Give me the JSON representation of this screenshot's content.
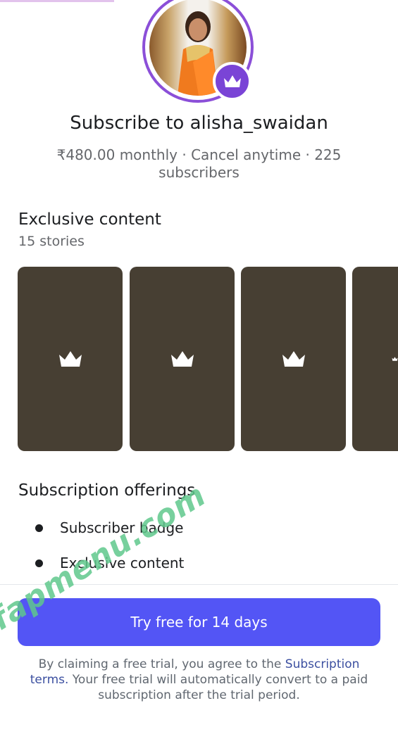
{
  "header": {
    "title": "Subscribe to alisha_swaidan",
    "subtitle": "₹480.00 monthly · Cancel anytime · 225 subscribers"
  },
  "exclusive": {
    "heading": "Exclusive content",
    "count_label": "15 stories",
    "cards": [
      {
        "icon": "crown-icon"
      },
      {
        "icon": "crown-icon"
      },
      {
        "icon": "crown-icon"
      },
      {
        "icon": "crown-icon"
      }
    ]
  },
  "offerings": {
    "heading": "Subscription offerings",
    "items": [
      "Subscriber badge",
      "Exclusive content"
    ]
  },
  "cta": {
    "label": "Try free for 14 days"
  },
  "legal": {
    "prefix": "By claiming a free trial, you agree to the ",
    "link": "Subscription terms.",
    "suffix": " Your free trial will automatically convert to a paid subscription after the trial period."
  },
  "watermark": "fapmenu.com",
  "colors": {
    "accent": "#5355f5",
    "badge": "#7a44d6",
    "card": "#473f33",
    "link": "#3b4fa0"
  }
}
